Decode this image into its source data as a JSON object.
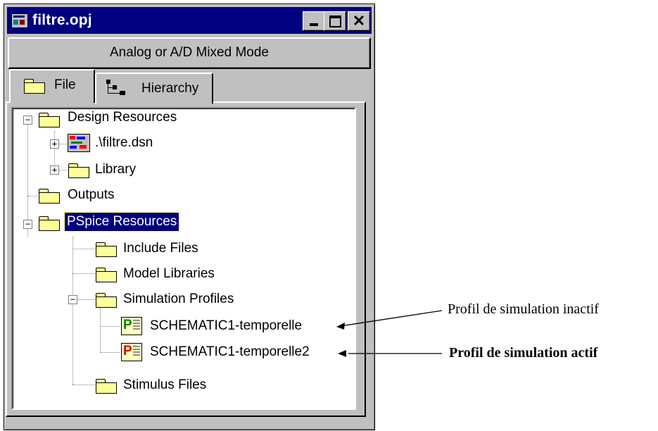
{
  "window": {
    "title": "filtre.opj",
    "mode_label": "Analog or A/D Mixed Mode",
    "controls": {
      "close": "✕"
    }
  },
  "tabs": [
    {
      "label": "File",
      "icon": "folder-icon",
      "active": true
    },
    {
      "label": "Hierarchy",
      "icon": "hierarchy-icon",
      "active": false
    }
  ],
  "tree": {
    "design_resources": "Design Resources",
    "dsn_file": ".\\filtre.dsn",
    "library": "Library",
    "outputs": "Outputs",
    "pspice_resources": "PSpice Resources",
    "include_files": "Include Files",
    "model_libraries": "Model Libraries",
    "simulation_profiles": "Simulation Profiles",
    "profile_inactive": "SCHEMATIC1-temporelle",
    "profile_active": "SCHEMATIC1-temporelle2",
    "stimulus_files": "Stimulus Files",
    "expand_minus": "−",
    "expand_plus": "+",
    "profile_icon_inactive": "P",
    "profile_icon_active": "P!"
  },
  "annotations": {
    "inactive": "Profil de simulation inactif",
    "active": "Profil de simulation actif"
  }
}
